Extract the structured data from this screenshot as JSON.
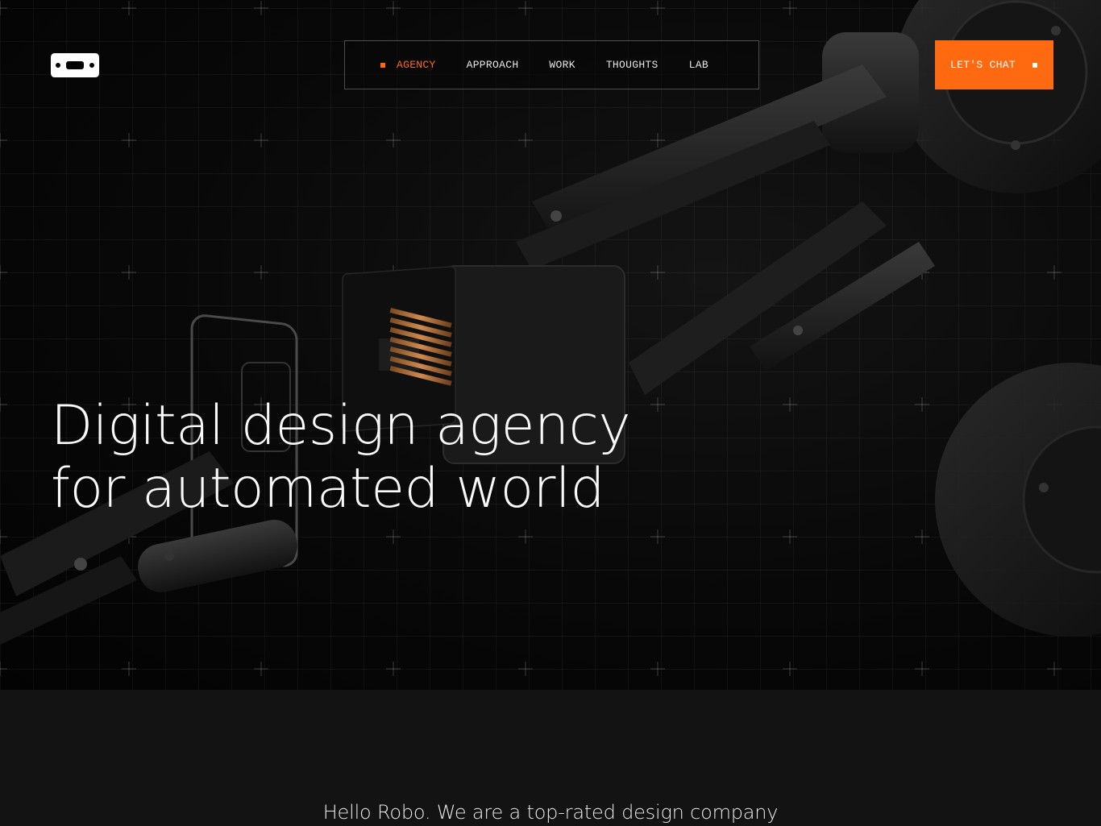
{
  "brand": {
    "logo": "robo-logo-icon"
  },
  "nav": {
    "items": [
      {
        "label": "AGENCY",
        "active": true
      },
      {
        "label": "APPROACH",
        "active": false
      },
      {
        "label": "WORK",
        "active": false
      },
      {
        "label": "THOUGHTS",
        "active": false
      },
      {
        "label": "LAB",
        "active": false
      }
    ]
  },
  "cta": {
    "label": "LET'S CHAT"
  },
  "hero": {
    "headline_line1": "Digital design agency",
    "headline_line2": "for automated world"
  },
  "intro": {
    "text": "Hello Robo. We are a top-rated design company"
  },
  "colors": {
    "accent": "#ff6a10",
    "background": "#000000",
    "section_bg": "#131314"
  }
}
